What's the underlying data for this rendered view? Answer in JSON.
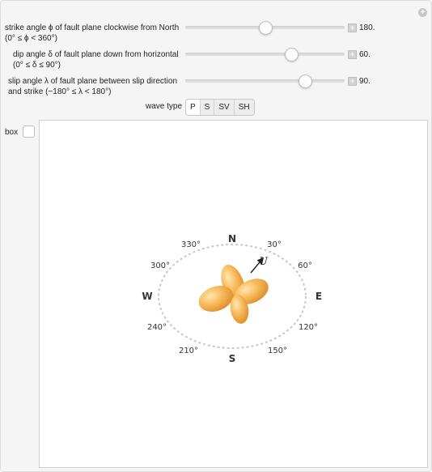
{
  "controls": {
    "strike": {
      "label_line1": "strike angle ϕ of fault plane clockwise from North",
      "label_line2": "(0° ≤ ϕ < 360°)",
      "value_text": "180.",
      "value": 180,
      "min": 0,
      "max": 360
    },
    "dip": {
      "label_line1": "dip angle δ of fault plane down from horizontal",
      "label_line2": "(0° ≤ δ ≤ 90°)",
      "value_text": "60.",
      "value": 60,
      "min": 0,
      "max": 90
    },
    "slip": {
      "label_line1": "slip angle λ of fault plane between slip direction",
      "label_line2": "and strike (−180° ≤ λ < 180°)",
      "value_text": "90.",
      "value": 90,
      "min": -180,
      "max": 180
    }
  },
  "wave_type": {
    "label": "wave type",
    "options": [
      "P",
      "S",
      "SV",
      "SH"
    ],
    "selected": "P"
  },
  "box": {
    "label": "box",
    "checked": false
  },
  "compass": {
    "north": "N",
    "south": "S",
    "east": "E",
    "west": "W",
    "angles": [
      "30°",
      "60°",
      "120°",
      "150°",
      "210°",
      "240°",
      "300°",
      "330°"
    ],
    "slip_vector_label": "U"
  },
  "colors": {
    "lobe_light": "#ffe0a0",
    "lobe_mid": "#f7b554",
    "lobe_dark": "#d98a2a",
    "compass_ring": "#c8c8c8"
  },
  "icons": {
    "corner": "plus-circle-icon",
    "increment": "plus-icon"
  }
}
